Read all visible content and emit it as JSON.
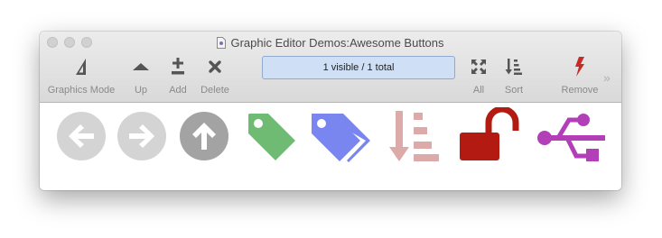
{
  "window": {
    "title": "Graphic Editor Demos:Awesome Buttons"
  },
  "toolbar": {
    "items": [
      {
        "label": "Graphics Mode",
        "icon": "triangle-ruler-icon"
      },
      {
        "label": "Up",
        "icon": "caret-up-icon"
      },
      {
        "label": "Add",
        "icon": "add-icon"
      },
      {
        "label": "Delete",
        "icon": "delete-icon"
      },
      {
        "label": "All",
        "icon": "expand-arrows-icon"
      },
      {
        "label": "Sort",
        "icon": "sort-icon"
      },
      {
        "label": "Remove",
        "icon": "lightning-icon"
      }
    ],
    "status": "1 visible / 1 total",
    "overflow": "»"
  },
  "buttons": [
    {
      "icon": "arrow-left-circle-icon",
      "color": "#d4d4d4"
    },
    {
      "icon": "arrow-right-circle-icon",
      "color": "#d4d4d4"
    },
    {
      "icon": "arrow-up-circle-icon",
      "color": "#a3a3a3"
    },
    {
      "icon": "tag-icon",
      "color": "#6fbb74"
    },
    {
      "icon": "tags-icon",
      "color": "#7a86ef"
    },
    {
      "icon": "sort-amount-desc-icon",
      "color": "#dcaaa8"
    },
    {
      "icon": "unlock-icon",
      "color": "#b31b12"
    },
    {
      "icon": "usb-icon",
      "color": "#b23fb8"
    }
  ]
}
